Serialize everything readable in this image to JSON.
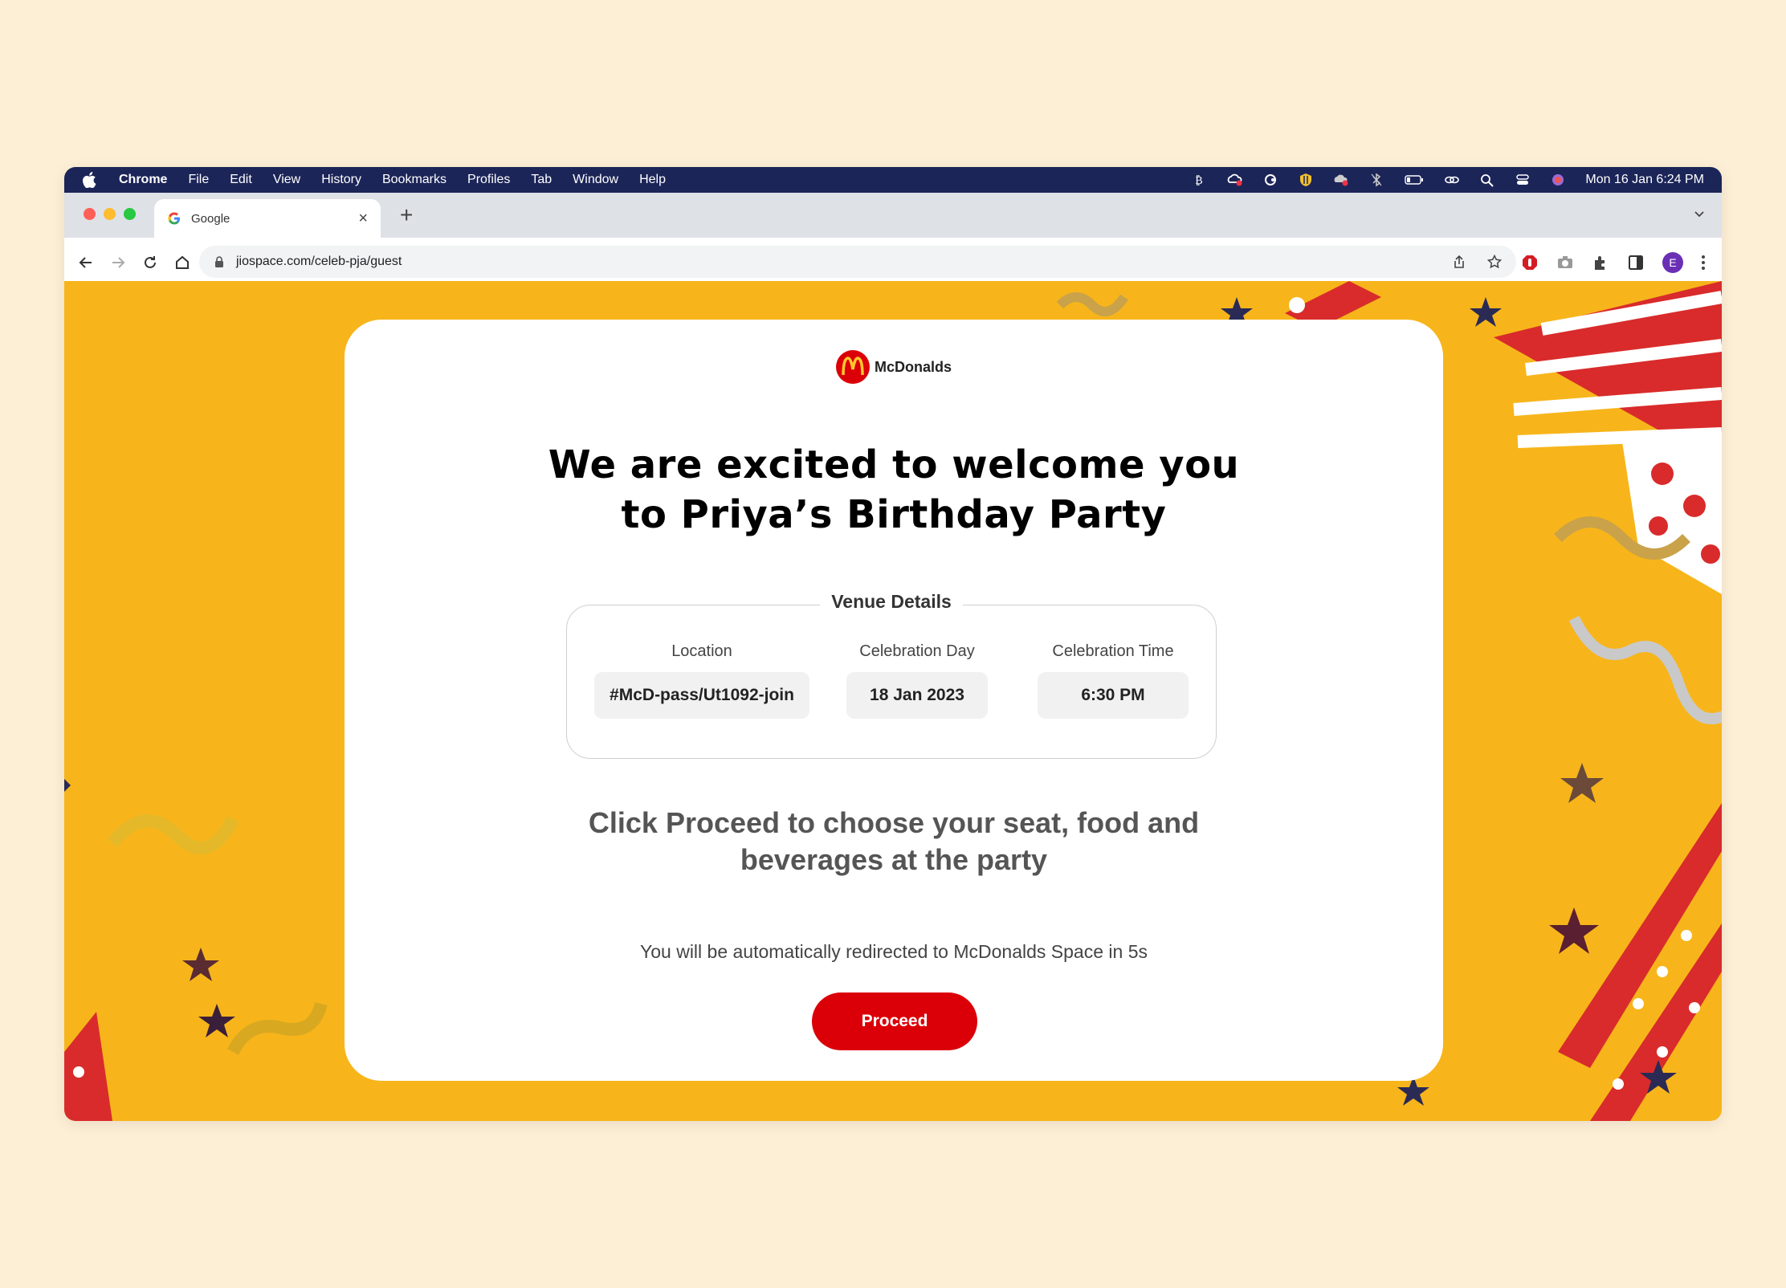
{
  "menubar": {
    "app": "Chrome",
    "items": [
      "File",
      "Edit",
      "View",
      "History",
      "Bookmarks",
      "Profiles",
      "Tab",
      "Window",
      "Help"
    ],
    "clock": "Mon 16 Jan  6:24 PM"
  },
  "tab": {
    "title": "Google"
  },
  "toolbar": {
    "url": "jiospace.com/celeb-pja/guest",
    "avatar_letter": "E"
  },
  "page": {
    "brand": "McDonalds",
    "headline_line1": "We are excited to welcome you",
    "headline_line2": "to Priya’s Birthday Party",
    "venue": {
      "title": "Venue Details",
      "location_label": "Location",
      "location_value": "#McD-pass/Ut1092-join",
      "day_label": "Celebration Day",
      "day_value": "18 Jan 2023",
      "time_label": "Celebration Time",
      "time_value": "6:30 PM"
    },
    "subtext_line1": "Click Proceed to choose your seat, food and",
    "subtext_line2": "beverages at the party",
    "redirect_text": "You will be automatically redirected to McDonalds Space in 5s",
    "proceed_label": "Proceed"
  },
  "colors": {
    "brand_red": "#db0007",
    "brand_yellow": "#ffc72c",
    "background": "#f7b51b",
    "menubar": "#1c2558"
  }
}
